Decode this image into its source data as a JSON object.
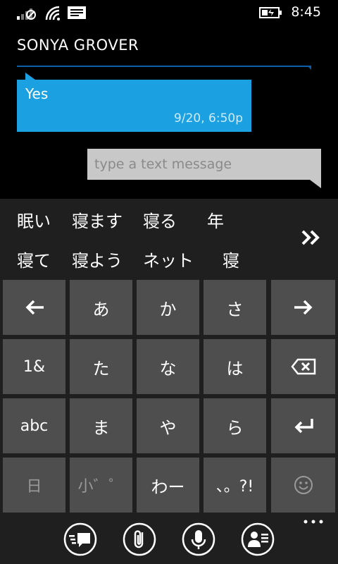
{
  "status_bar": {
    "time": "8:45",
    "icons": [
      "signal-icon",
      "wifi-icon",
      "message-notification-icon",
      "battery-charging-icon"
    ]
  },
  "header": {
    "contact_name": "SONYA GROVER"
  },
  "conversation": {
    "messages": [
      {
        "text": "Yes",
        "timestamp": "9/20, 6:50p",
        "direction": "incoming"
      }
    ],
    "compose": {
      "placeholder": "type a text message",
      "value": ""
    }
  },
  "candidates": {
    "row1": [
      "眠い",
      "寝ます",
      "寝る",
      "年"
    ],
    "row2": [
      "寝て",
      "寝よう",
      "ネット",
      "寝"
    ],
    "more_icon": "double-chevron-right-icon"
  },
  "keyboard": {
    "rows": [
      [
        {
          "label": "",
          "icon": "arrow-left-icon"
        },
        {
          "label": "あ"
        },
        {
          "label": "か"
        },
        {
          "label": "さ"
        },
        {
          "label": "",
          "icon": "arrow-right-icon"
        }
      ],
      [
        {
          "label": "1&"
        },
        {
          "label": "た"
        },
        {
          "label": "な"
        },
        {
          "label": "は"
        },
        {
          "label": "",
          "icon": "backspace-icon"
        }
      ],
      [
        {
          "label": "abc"
        },
        {
          "label": "ま"
        },
        {
          "label": "や"
        },
        {
          "label": "ら"
        },
        {
          "label": "",
          "icon": "enter-icon"
        }
      ],
      [
        {
          "label": "日"
        },
        {
          "label": "小゛゜"
        },
        {
          "label": "わー"
        },
        {
          "label": "、。?!"
        },
        {
          "label": "",
          "icon": "emoji-icon"
        }
      ]
    ]
  },
  "app_bar": {
    "buttons": [
      "switch-conversation-icon",
      "attach-icon",
      "voice-icon",
      "contact-card-icon"
    ],
    "more_icon": "more-dots-icon"
  },
  "colors": {
    "accent": "#1ba1e2",
    "keyboard_bg": "#1f1f1f",
    "key_bg": "#4e4e4e",
    "compose_bg": "#c8c8c8"
  }
}
